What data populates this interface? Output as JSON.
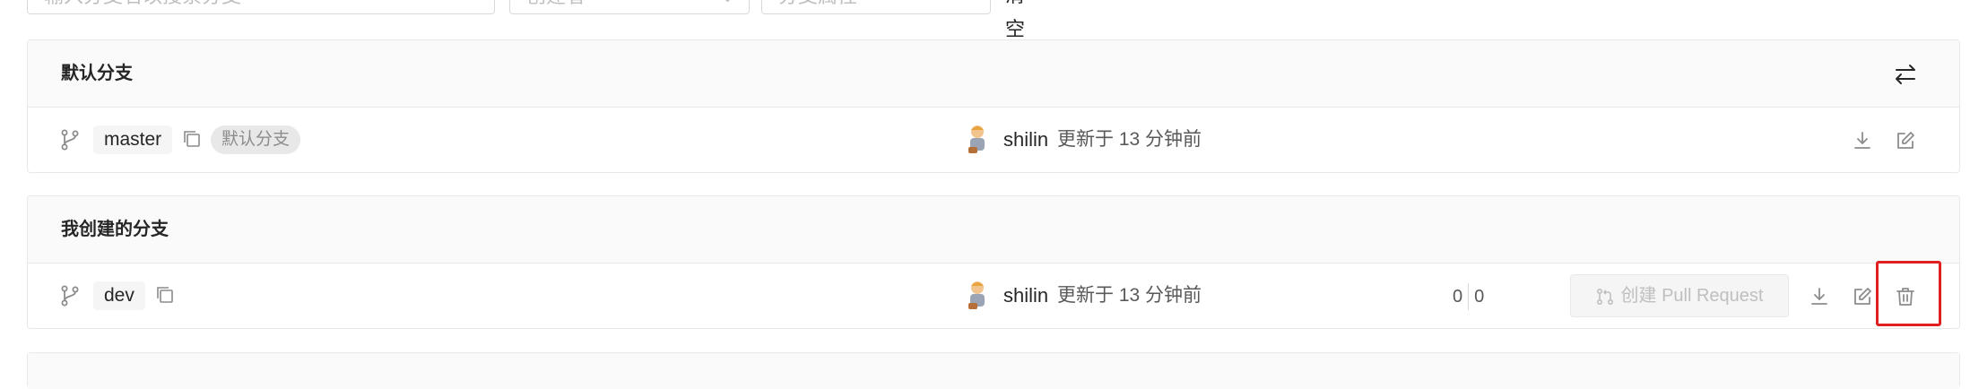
{
  "filters": {
    "search_placeholder": "输入分支名以搜索分支",
    "creator_placeholder": "创建者",
    "attr_placeholder": "分支属性",
    "clear_label": "清空"
  },
  "default_section": {
    "title": "默认分支",
    "branch": {
      "name": "master",
      "tag": "默认分支",
      "author": "shilin",
      "updated": "更新于 13 分钟前"
    }
  },
  "mine_section": {
    "title": "我创建的分支",
    "branch": {
      "name": "dev",
      "author": "shilin",
      "updated": "更新于 13 分钟前",
      "behind": "0",
      "ahead": "0",
      "pr_label": "创建 Pull Request"
    }
  },
  "colors": {
    "highlight": "#e02020",
    "header_bg": "#fafafa",
    "disabled_text": "#bfbfbf"
  },
  "icons": [
    "branch-icon",
    "copy-icon",
    "swap-icon",
    "download-icon",
    "edit-icon",
    "delete-icon",
    "pull-request-icon",
    "chevron-down-icon"
  ]
}
